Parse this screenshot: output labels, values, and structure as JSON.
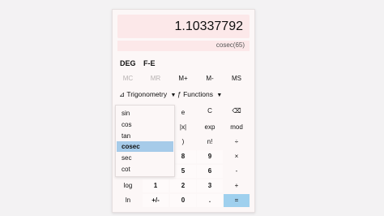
{
  "display": {
    "value": "1.10337792",
    "expression": "cosec(65)"
  },
  "modes": {
    "angle": "DEG",
    "notation": "F-E"
  },
  "memory": [
    {
      "label": "MC",
      "enabled": false
    },
    {
      "label": "MR",
      "enabled": false
    },
    {
      "label": "M+",
      "enabled": true
    },
    {
      "label": "M-",
      "enabled": true
    },
    {
      "label": "MS",
      "enabled": true
    }
  ],
  "dropdowns": {
    "trig": {
      "icon": "⊿",
      "label": "Trigonometry"
    },
    "functions": {
      "icon": "ƒ",
      "label": "Functions"
    }
  },
  "trig_menu": {
    "items": [
      "sin",
      "cos",
      "tan",
      "cosec",
      "sec",
      "cot"
    ],
    "selected": "cosec"
  },
  "keys": {
    "e": "e",
    "clear": "C",
    "backspace": "⌫",
    "abs": "|x|",
    "exp": "exp",
    "mod": "mod",
    "paren_close": ")",
    "factorial": "n!",
    "divide": "÷",
    "k8": "8",
    "k9": "9",
    "multiply": "×",
    "k5": "5",
    "k6": "6",
    "minus": "-",
    "log": "log",
    "k1": "1",
    "k2": "2",
    "k3": "3",
    "plus": "+",
    "ln": "ln",
    "negate": "+/-",
    "k0": "0",
    "decimal": ".",
    "equals": "="
  },
  "colors": {
    "display_bg": "#fce8e9",
    "equals_bg": "#9fd0ee",
    "selected_item_bg": "#a6cbe9"
  }
}
